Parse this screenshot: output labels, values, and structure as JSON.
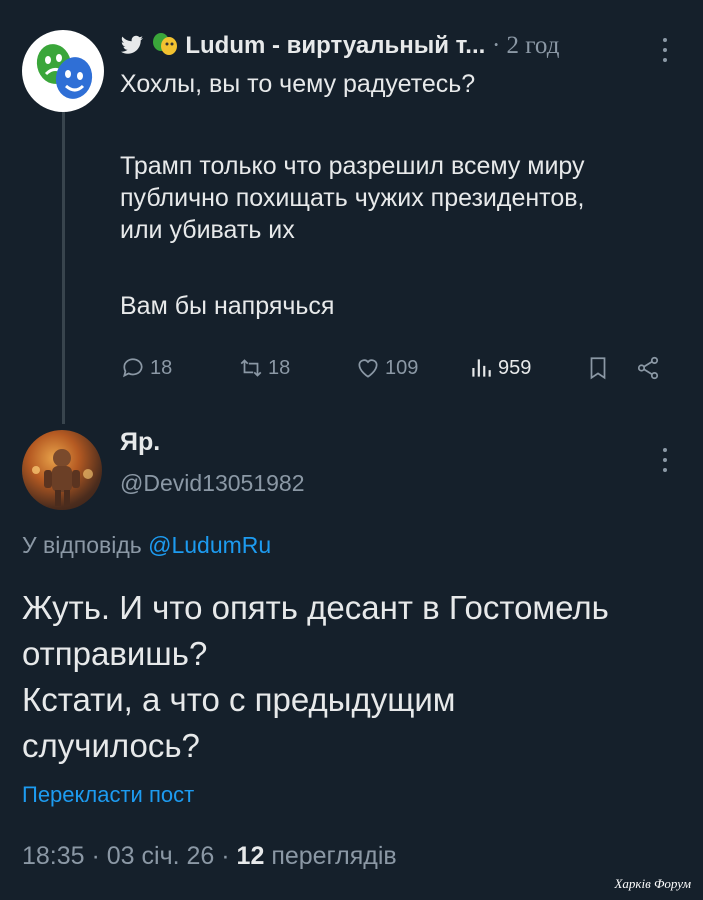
{
  "tweet1": {
    "display_name": "Ludum - виртуальный т...",
    "time": "2 год",
    "lines": [
      "Хохлы, вы то чему радуетесь?",
      "",
      "Трамп только что разрешил всему миру",
      "публично похищать чужих президентов,",
      "или убивать их",
      "",
      "Вам бы напрячься"
    ],
    "stats": {
      "replies": "18",
      "reposts": "18",
      "likes": "109",
      "views": "959"
    }
  },
  "tweet2": {
    "display_name": "Яр.",
    "handle": "@Devid13051982",
    "reply_prefix": "У відповідь",
    "reply_handle": "@LudumRu",
    "lines": [
      "Жуть. И что опять десант в Гостомель",
      "отправишь?",
      "Кстати, а что с предыдущим",
      "случилось?"
    ],
    "translate": "Перекласти пост",
    "meta_prefix": "18:35 · 03 січ. 26 ·",
    "views_count": "12",
    "views_label": "переглядів"
  },
  "watermark": "Харків Форум",
  "colors": {
    "background": "#15202b",
    "text": "#e7e9ea",
    "muted": "#8b98a5",
    "accent": "#1d9bf0"
  },
  "icons": [
    "twitter-bird-icon",
    "theatre-masks-icon",
    "reply-icon",
    "repost-icon",
    "like-icon",
    "views-icon",
    "bookmark-icon",
    "share-icon",
    "more-icon"
  ]
}
